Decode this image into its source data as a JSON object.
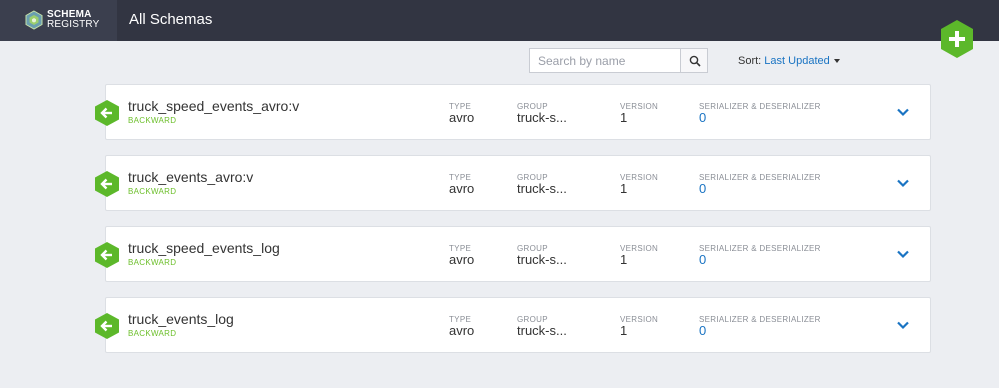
{
  "header": {
    "brand_line1": "SCHEMA",
    "brand_line2": "REGISTRY",
    "title": "All Schemas",
    "add_icon": "plus-icon"
  },
  "search": {
    "placeholder": "Search by name",
    "value": "",
    "icon": "search-icon"
  },
  "sort": {
    "label": "Sort:",
    "value": "Last Updated"
  },
  "columns": {
    "type": "TYPE",
    "group": "GROUP",
    "version": "VERSION",
    "serde": "SERIALIZER & DESERIALIZER"
  },
  "schemas": [
    {
      "name": "truck_speed_events_avro:v",
      "compatibility": "BACKWARD",
      "type": "avro",
      "group": "truck-s...",
      "version": "1",
      "serde": "0"
    },
    {
      "name": "truck_events_avro:v",
      "compatibility": "BACKWARD",
      "type": "avro",
      "group": "truck-s...",
      "version": "1",
      "serde": "0"
    },
    {
      "name": "truck_speed_events_log",
      "compatibility": "BACKWARD",
      "type": "avro",
      "group": "truck-s...",
      "version": "1",
      "serde": "0"
    },
    {
      "name": "truck_events_log",
      "compatibility": "BACKWARD",
      "type": "avro",
      "group": "truck-s...",
      "version": "1",
      "serde": "0"
    }
  ],
  "colors": {
    "topbar": "#323542",
    "accent_green": "#6cbf2a",
    "link_blue": "#1a74c3"
  }
}
